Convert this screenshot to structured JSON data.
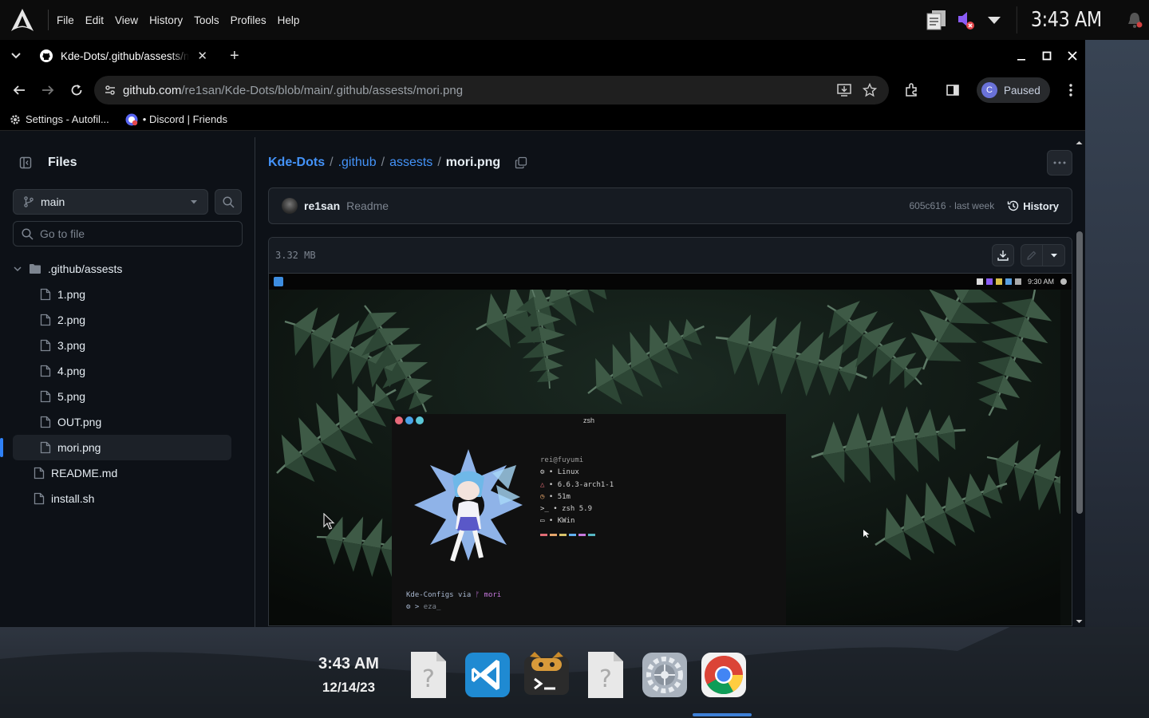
{
  "top_panel": {
    "menu": [
      "File",
      "Edit",
      "View",
      "History",
      "Tools",
      "Profiles",
      "Help"
    ],
    "clock": "3:43 AM"
  },
  "browser": {
    "tab_title": "Kde-Dots/.github/assests/mori.png",
    "url_host": "github.com",
    "url_path": "/re1san/Kde-Dots/blob/main/.github/assests/mori.png",
    "profile_initial": "C",
    "profile_status": "Paused",
    "bookmarks": [
      "Settings - Autofil...",
      "• Discord | Friends"
    ]
  },
  "sidebar": {
    "title": "Files",
    "branch": "main",
    "goto_placeholder": "Go to file",
    "folder": ".github/assests",
    "folder_files": [
      "1.png",
      "2.png",
      "3.png",
      "4.png",
      "5.png",
      "OUT.png",
      "mori.png"
    ],
    "root_files": [
      "README.md",
      "install.sh"
    ],
    "selected": "mori.png"
  },
  "breadcrumb": {
    "repo": "Kde-Dots",
    "p1": ".github",
    "p2": "assests",
    "file": "mori.png",
    "sep": "/"
  },
  "commit": {
    "user": "re1san",
    "message": "Readme",
    "meta": "605c616 · last week",
    "history_label": "History"
  },
  "file": {
    "size": "3.32 MB"
  },
  "preview": {
    "tray_time": "9:30 AM",
    "term_title": "zsh",
    "fetch_user": "rei@fuyumi",
    "fetch_lines": [
      "Linux",
      "6.6.3-arch1-1",
      "51m",
      "zsh 5.9",
      "KWin"
    ],
    "prompt_line1": "Kde-Configs via",
    "prompt_branch": "mori",
    "prompt_line2": "eza_",
    "swatch_colors": [
      "#e06c75",
      "#e5a56b",
      "#d7c26a",
      "#61afef",
      "#c678dd",
      "#56b6c2"
    ]
  },
  "dock": {
    "time": "3:43 AM",
    "date": "12/14/23",
    "apps": [
      "unknown-file-icon",
      "vscode-icon",
      "terminal-icon",
      "unknown-file-icon",
      "settings-icon",
      "chrome-icon"
    ],
    "active_app": "chrome-icon"
  }
}
